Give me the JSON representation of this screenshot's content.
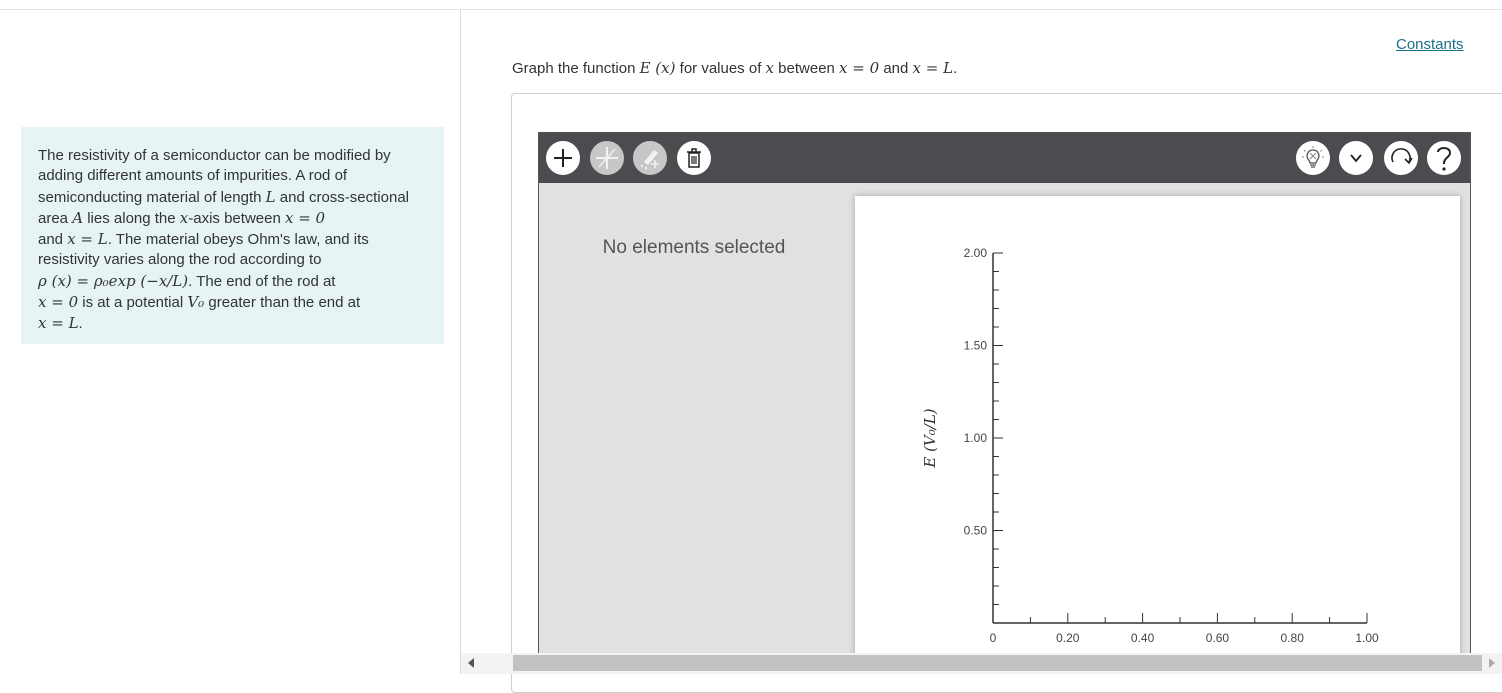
{
  "problem": {
    "text_1": "The resistivity of a semiconductor can be modified by adding different amounts of impurities. A rod of semiconducting material of length ",
    "sym_L": "L",
    "text_2": " and cross-sectional area ",
    "sym_A": "A",
    "text_3": " lies along the ",
    "sym_x": "x",
    "text_4": "-axis between ",
    "eq_x0": "x = 0",
    "text_5": " and ",
    "eq_xL": "x = L",
    "text_6": ". The material obeys Ohm's law, and its resistivity varies along the rod according to",
    "eq_rho": "ρ (x) = ρ₀exp (−x/L)",
    "text_7": ". The end of the rod at",
    "eq_x0b": "x = 0",
    "text_8": " is at a potential ",
    "sym_V0": "V₀",
    "text_9": " greater than the end at",
    "eq_xL2": "x = L",
    "text_10": "."
  },
  "header": {
    "constants_link": "Constants"
  },
  "prompt": {
    "t1": "Graph the function ",
    "f": "E (x)",
    "t2": " for values of ",
    "x": "x",
    "t3": " between ",
    "a": "x = 0",
    "t4": " and ",
    "b": "x = L",
    "t5": "."
  },
  "tool": {
    "buttons_left": [
      "add-icon",
      "add-line-icon",
      "edit-add-icon",
      "delete-icon"
    ],
    "buttons_right": [
      "hint-lightbulb-icon",
      "chevron-down-icon",
      "reset-icon",
      "help-icon"
    ],
    "side_panel_message": "No elements selected"
  },
  "colors": {
    "toolbar_bg": "#4b4b50",
    "panel_bg": "#e1e1e1",
    "link": "#1a6f8a",
    "problem_bg": "#e6f4f6"
  },
  "chart_data": {
    "type": "scatter",
    "series": [],
    "xlabel": "",
    "ylabel": "E (V₀/L)",
    "xlim": [
      0,
      1.0
    ],
    "ylim": [
      0,
      2.0
    ],
    "x_ticks": [
      "0",
      "0.20",
      "0.40",
      "0.60",
      "0.80",
      "1.00"
    ],
    "y_ticks": [
      "0.50",
      "1.00",
      "1.50",
      "2.00"
    ],
    "grid": false
  }
}
